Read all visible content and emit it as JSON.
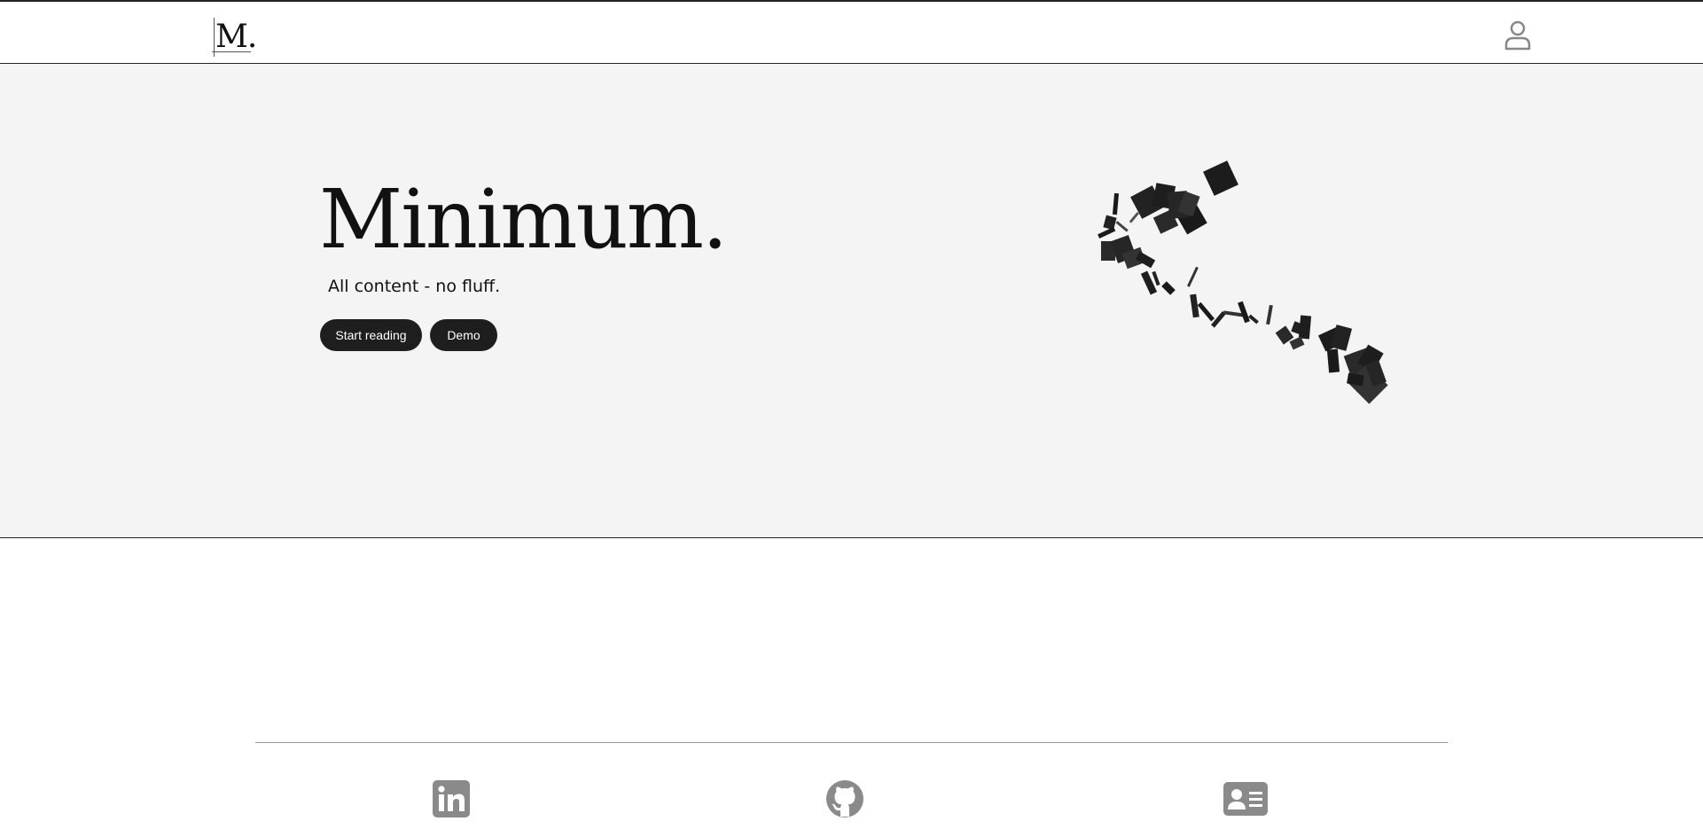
{
  "header": {
    "logo_text": "M.",
    "user_icon": "user-icon"
  },
  "hero": {
    "title": "Minimum.",
    "subtitle": "All content - no fluff.",
    "buttons": {
      "start_reading": "Start reading",
      "demo": "Demo"
    },
    "art": "scattered-squares-illustration"
  },
  "footer": {
    "icons": [
      "linkedin-icon",
      "github-icon",
      "contact-card-icon"
    ]
  },
  "colors": {
    "hero_background": "#f4f4f4",
    "button_background": "#1e1e1e",
    "icon_gray": "#8a8a8a"
  }
}
